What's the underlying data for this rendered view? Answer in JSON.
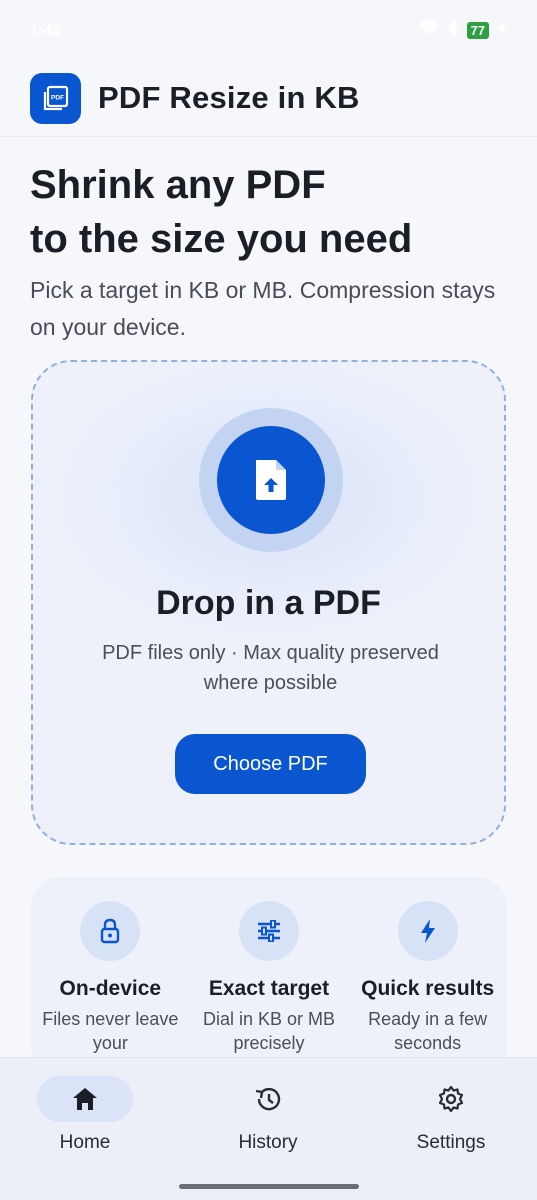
{
  "status_bar": {
    "time": "1:43",
    "battery": "77"
  },
  "app_bar": {
    "title": "PDF Resize in KB",
    "logo_text": "PDF"
  },
  "hero": {
    "title_line1": "Shrink any PDF",
    "title_line2": "to the size you need",
    "subtitle": "Pick a target in KB or MB. Compression stays on your device."
  },
  "drop_zone": {
    "title": "Drop in a PDF",
    "subtitle": "PDF files only · Max quality preserved where possible",
    "button_label": "Choose PDF"
  },
  "features": [
    {
      "icon": "lock-icon",
      "title": "On-device",
      "desc": "Files never leave your"
    },
    {
      "icon": "sliders-icon",
      "title": "Exact target",
      "desc": "Dial in KB or MB precisely"
    },
    {
      "icon": "bolt-icon",
      "title": "Quick results",
      "desc": "Ready in a few seconds"
    }
  ],
  "bottom_nav": {
    "items": [
      {
        "label": "Home",
        "icon": "home-icon",
        "active": true
      },
      {
        "label": "History",
        "icon": "history-icon",
        "active": false
      },
      {
        "label": "Settings",
        "icon": "gear-icon",
        "active": false
      }
    ]
  },
  "colors": {
    "primary": "#0a56d1",
    "background": "#f6f7fb",
    "drop_border": "#8fb1dc",
    "nav_active_pill": "#dbe3f8",
    "battery": "#2ea043"
  }
}
